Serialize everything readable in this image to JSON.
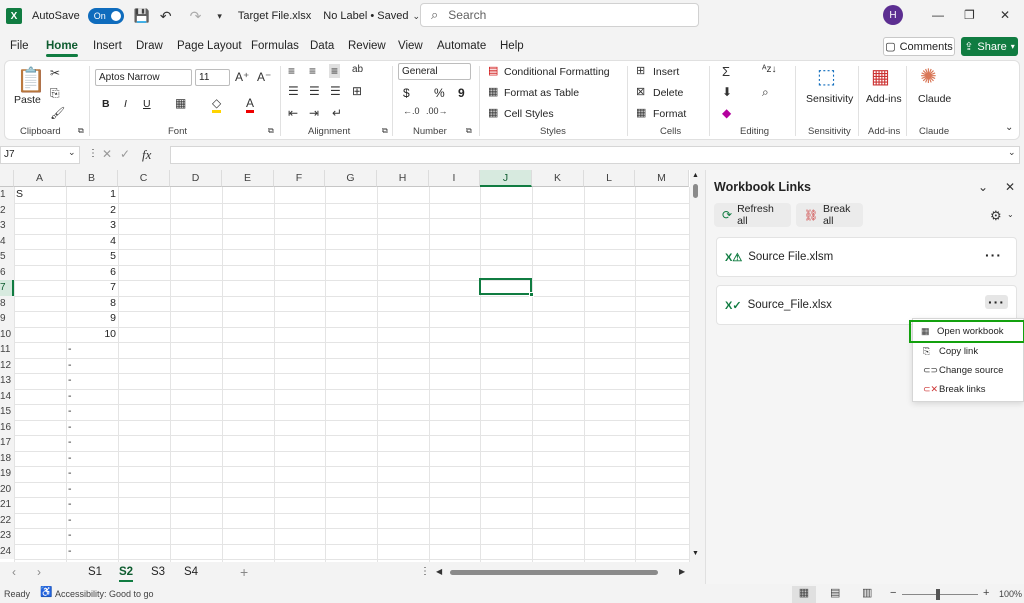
{
  "titlebar": {
    "autosave_label": "AutoSave",
    "autosave_state": "On",
    "file_name": "Target File.xlsx",
    "label_status": "No Label • Saved",
    "search_placeholder": "Search",
    "user_initial": "H"
  },
  "menu": {
    "items": [
      "File",
      "Home",
      "Insert",
      "Draw",
      "Page Layout",
      "Formulas",
      "Data",
      "Review",
      "View",
      "Automate",
      "Help"
    ],
    "active": "Home",
    "comments": "Comments",
    "share": "Share"
  },
  "ribbon": {
    "clipboard": {
      "label": "Clipboard",
      "paste": "Paste"
    },
    "font": {
      "label": "Font",
      "name": "Aptos Narrow",
      "size": "11",
      "bold": "B",
      "italic": "I",
      "underline": "U"
    },
    "alignment": {
      "label": "Alignment"
    },
    "number": {
      "label": "Number",
      "format": "General",
      "currency": "$",
      "percent": "%",
      "comma": "9"
    },
    "styles": {
      "label": "Styles",
      "conditional": "Conditional Formatting",
      "format_table": "Format as Table",
      "cell_styles": "Cell Styles"
    },
    "cells": {
      "label": "Cells",
      "insert": "Insert",
      "delete": "Delete",
      "format": "Format"
    },
    "editing": {
      "label": "Editing"
    },
    "sensitivity": {
      "label": "Sensitivity",
      "button": "Sensitivity"
    },
    "addins": {
      "label": "Add-ins",
      "button": "Add-ins"
    },
    "claude": {
      "label": "Claude",
      "button": "Claude"
    }
  },
  "formula_bar": {
    "name_box": "J7",
    "fx": "fx",
    "value": ""
  },
  "sheet": {
    "columns": [
      "A",
      "B",
      "C",
      "D",
      "E",
      "F",
      "G",
      "H",
      "I",
      "J",
      "K",
      "L",
      "M"
    ],
    "active_column": "J",
    "rows": [
      "1",
      "2",
      "3",
      "4",
      "5",
      "6",
      "7",
      "8",
      "9",
      "10",
      "11",
      "12",
      "13",
      "14",
      "15",
      "16",
      "17",
      "18",
      "19",
      "20",
      "21",
      "22",
      "23",
      "24"
    ],
    "colA": [
      "S",
      "",
      "",
      "",
      "",
      "",
      "",
      "",
      "",
      "",
      "",
      "",
      "",
      "",
      "",
      "",
      "",
      "",
      "",
      "",
      "",
      "",
      "",
      ""
    ],
    "colB": [
      "1",
      "2",
      "3",
      "4",
      "5",
      "6",
      "7",
      "8",
      "9",
      "10",
      "-",
      "-",
      "-",
      "-",
      "-",
      "-",
      "-",
      "-",
      "-",
      "-",
      "-",
      "-",
      "-",
      "-"
    ],
    "selected_cell": "J7"
  },
  "sheet_tabs": {
    "items": [
      "S1",
      "S2",
      "S3",
      "S4"
    ],
    "active": "S2"
  },
  "status": {
    "ready": "Ready",
    "accessibility": "Accessibility: Good to go",
    "zoom": "100%"
  },
  "pane": {
    "title": "Workbook Links",
    "refresh_all": "Refresh all",
    "break_all": "Break all",
    "links": [
      {
        "name": "Source File.xlsm"
      },
      {
        "name": "Source_File.xlsx"
      }
    ],
    "context_menu": [
      "Open workbook",
      "Copy link",
      "Change source",
      "Break links"
    ]
  },
  "colors": {
    "accent": "#107c41",
    "highlight": "#13a10e",
    "toggle": "#0f6cbd"
  }
}
